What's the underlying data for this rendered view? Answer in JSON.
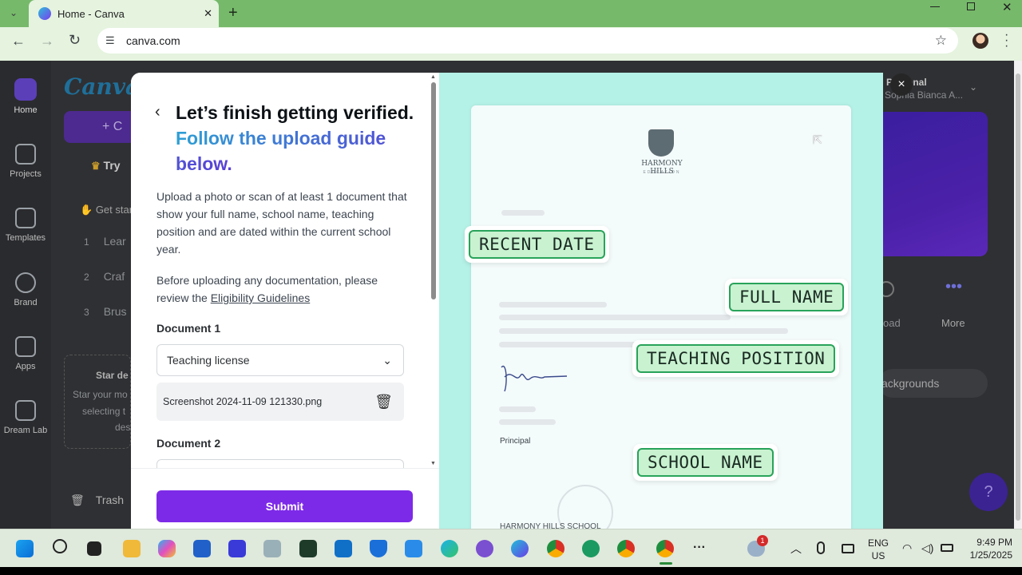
{
  "browser": {
    "tab_title": "Home - Canva",
    "url": "canva.com",
    "new_tab_symbol": "+",
    "close_tab_symbol": "✕"
  },
  "canva_bg": {
    "logo": "Canva",
    "rail": [
      {
        "label": "Home"
      },
      {
        "label": "Projects"
      },
      {
        "label": "Templates"
      },
      {
        "label": "Brand"
      },
      {
        "label": "Apps"
      },
      {
        "label": "Dream Lab"
      }
    ],
    "create_button": "+ C",
    "try_text": "Try",
    "get_started": "Get star",
    "steps": [
      {
        "num": "1",
        "label": "Lear"
      },
      {
        "num": "2",
        "label": "Craf"
      },
      {
        "num": "3",
        "label": "Brus"
      }
    ],
    "star_title": "Star de",
    "star_text_1": "Star your mo",
    "star_text_2": "selecting t",
    "star_text_3": "des",
    "trash": "Trash",
    "account_type": "Personal",
    "account_name": "Sophia Bianca A...",
    "upload_label": "oad",
    "more_label": "More",
    "backgrounds_label": "ackgrounds",
    "help_symbol": "?"
  },
  "modal": {
    "heading_plain": "Let’s finish getting verified.",
    "heading_accent": "Follow the upload guide below.",
    "para1": "Upload a photo or scan of at least 1 document that show your full name, school name, teaching position and are dated within the current school year.",
    "para2_prefix": "Before uploading any documentation, please review the ",
    "para2_link": "Eligibility Guidelines",
    "doc1_label": "Document 1",
    "doc1_select": "Teaching license",
    "doc1_file": "Screenshot 2024-11-09 121330.png",
    "doc2_label": "Document 2",
    "submit": "Submit",
    "close_symbol": "×"
  },
  "illustration": {
    "school_name": "HARMONY HILLS",
    "school_sub": "EDUCATION",
    "principal": "Principal",
    "footer_school": "HARMONY HILLS SCHOOL",
    "tags": {
      "recent_date": "RECENT DATE",
      "full_name": "FULL NAME",
      "teaching_position": "TEACHING POSITION",
      "school_name": "SCHOOL NAME"
    }
  },
  "taskbar": {
    "lang": "ENG",
    "region": "US",
    "time": "9:49 PM",
    "date": "1/25/2025",
    "notification_count": "1",
    "more_symbol": "···"
  },
  "colors": {
    "chrome_frame": "#76b96a",
    "canva_purple": "#7d2ae8",
    "tag_green": "#28a35a",
    "illustration_bg": "#b4f1e6"
  }
}
